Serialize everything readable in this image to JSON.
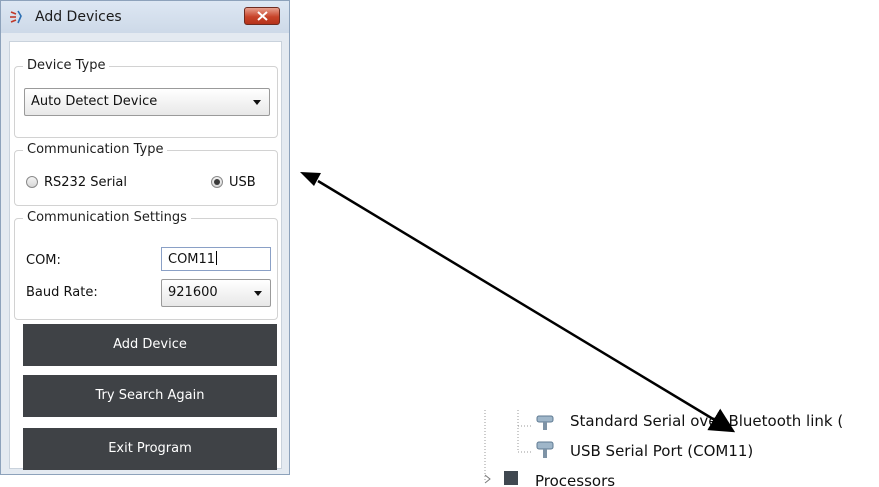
{
  "window": {
    "title": "Add Devices",
    "close_label": "close"
  },
  "device_type": {
    "legend": "Device Type",
    "selected": "Auto Detect Device"
  },
  "communication_type": {
    "legend": "Communication Type",
    "options": [
      {
        "label": "RS232 Serial",
        "selected": false
      },
      {
        "label": "USB",
        "selected": true
      }
    ]
  },
  "communication_settings": {
    "legend": "Communication Settings",
    "com_label": "COM:",
    "com_value": "COM11",
    "baud_label": "Baud Rate:",
    "baud_value": "921600"
  },
  "buttons": {
    "add": "Add Device",
    "retry": "Try Search Again",
    "exit": "Exit Program"
  },
  "device_manager": {
    "items": [
      "Standard Serial over Bluetooth link (",
      "USB Serial Port (COM11)",
      "Processors"
    ]
  },
  "colors": {
    "button_bg": "#3f4246",
    "arrow": "#000000"
  },
  "icons": [
    "app-icon",
    "close-icon",
    "dropdown-arrow-icon",
    "serial-port-icon",
    "processor-icon",
    "expand-arrow-icon"
  ]
}
